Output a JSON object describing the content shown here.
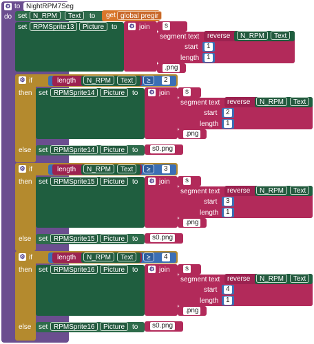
{
  "procedure": {
    "to_label": "to",
    "name": "NightRPM7Seg",
    "do_label": "do"
  },
  "set_label": "set",
  "to_label": "to",
  "n_rpm": "N_RPM",
  "text_prop": "Text",
  "picture_prop": "Picture",
  "get_label": "get",
  "global_var": "global pregir",
  "join_label": "join",
  "segment_label": "segment text",
  "reverse_label": "reverse",
  "start_label": "start",
  "length_label": "length",
  "if_label": "if",
  "then_label": "then",
  "else_label": "else",
  "ge_op": "≥",
  "s_text": "s",
  "png_text": ".png",
  "s0png_text": "s0.png",
  "block1": {
    "sprite": "RPMSprite13",
    "start": "1",
    "length": "1"
  },
  "block2": {
    "sprite": "RPMSprite14",
    "cmp": "2",
    "start": "2",
    "length": "1"
  },
  "block3": {
    "sprite": "RPMSprite15",
    "cmp": "3",
    "start": "3",
    "length": "1"
  },
  "block4": {
    "sprite": "RPMSprite16",
    "cmp": "4",
    "start": "4",
    "length": "1"
  }
}
